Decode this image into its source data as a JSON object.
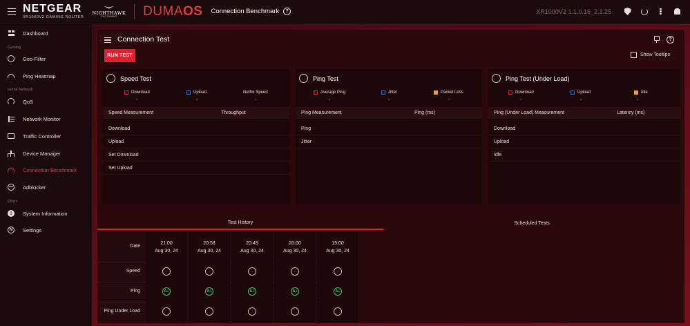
{
  "header": {
    "brand": "NETGEAR",
    "brand_sub": "XR1000V2 GAMING ROUTER",
    "nighthawk": "NIGHTHAWK",
    "nighthawk_sub": "PRO GAMING",
    "duma_light": "DUMA",
    "duma_bold": "OS",
    "page_name": "Connection Benchmark",
    "version": "XR1000V2 1.1.0.16_2.1.25"
  },
  "sidebar": {
    "items": [
      {
        "label": "Dashboard",
        "icon": "dashboard-icon"
      },
      {
        "label": "Geo-Filter",
        "icon": "geo-filter-icon"
      },
      {
        "label": "Ping Heatmap",
        "icon": "ping-heatmap-icon"
      },
      {
        "label": "QoS",
        "icon": "qos-icon"
      },
      {
        "label": "Network Monitor",
        "icon": "network-monitor-icon"
      },
      {
        "label": "Traffic Controller",
        "icon": "traffic-controller-icon"
      },
      {
        "label": "Device Manager",
        "icon": "device-manager-icon"
      },
      {
        "label": "Connection Benchmark",
        "icon": "connection-benchmark-icon",
        "active": true
      },
      {
        "label": "Adblocker",
        "icon": "adblocker-icon"
      },
      {
        "label": "System Information",
        "icon": "system-information-icon"
      },
      {
        "label": "Settings",
        "icon": "settings-icon"
      }
    ],
    "sections": [
      "Gaming",
      "Home Network",
      "Other"
    ]
  },
  "main": {
    "title": "Connection Test",
    "run_button": "RUN TEST",
    "show_tooltips": "Show Tooltips"
  },
  "panels": [
    {
      "title": "Speed Test",
      "legend": [
        {
          "label": "Download",
          "color": "#e3202f",
          "value": "-"
        },
        {
          "label": "Upload",
          "color": "#2f6fe0",
          "value": "-"
        },
        {
          "label": "Netflix Speed",
          "color": "",
          "value": "-"
        }
      ],
      "columns": [
        "Speed Measurement",
        "Throughput"
      ],
      "rows": [
        "Download",
        "Upload",
        "Set Download",
        "Set Upload"
      ]
    },
    {
      "title": "Ping Test",
      "legend": [
        {
          "label": "Average Ping",
          "color": "#e3202f",
          "value": "-"
        },
        {
          "label": "Jitter",
          "color": "#2f6fe0",
          "value": "-"
        },
        {
          "label": "Packet Loss",
          "color": "#f0a030",
          "value": "-"
        }
      ],
      "columns": [
        "Ping Measurement",
        "Ping (ms)"
      ],
      "rows": [
        "Ping",
        "Jitter"
      ]
    },
    {
      "title": "Ping Test (Under Load)",
      "legend": [
        {
          "label": "Download",
          "color": "#e3202f",
          "value": "-"
        },
        {
          "label": "Upload",
          "color": "#2f6fe0",
          "value": "-"
        },
        {
          "label": "Idle",
          "color": "#f0a030",
          "value": "-"
        }
      ],
      "columns": [
        "Ping (Under Load) Measurement",
        "Latency (ms)"
      ],
      "rows": [
        "Download",
        "Upload",
        "Idle"
      ]
    }
  ],
  "tabs": [
    {
      "label": "Test History",
      "active": true
    },
    {
      "label": "Scheduled Tests",
      "active": false
    }
  ],
  "history": {
    "row_labels": [
      "Date",
      "Speed",
      "Ping",
      "Ping Under Load"
    ],
    "columns": [
      {
        "time": "21:00",
        "date": "Aug 30, 24",
        "speed": "-",
        "ping": "A+",
        "under_load": ""
      },
      {
        "time": "20:58",
        "date": "Aug 30, 24",
        "speed": "-",
        "ping": "A+",
        "under_load": ""
      },
      {
        "time": "20:49",
        "date": "Aug 30, 24",
        "speed": "-",
        "ping": "A+",
        "under_load": ""
      },
      {
        "time": "20:00",
        "date": "Aug 30, 24",
        "speed": "-",
        "ping": "A+",
        "under_load": ""
      },
      {
        "time": "19:00",
        "date": "Aug 30, 24",
        "speed": "-",
        "ping": "A+",
        "under_load": ""
      }
    ]
  },
  "colors": {
    "accent": "#e3202f",
    "grade_good": "#4cc467",
    "download": "#e3202f",
    "upload": "#2f6fe0",
    "packet_loss": "#f0a030"
  }
}
